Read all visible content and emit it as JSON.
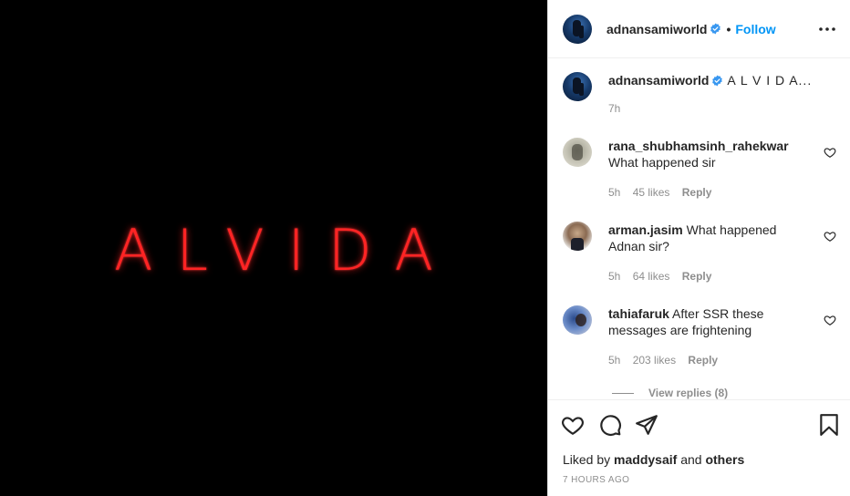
{
  "post": {
    "media_text": "ALVIDA",
    "username": "adnansamiworld",
    "follow_label": "Follow",
    "separator": "•"
  },
  "caption": {
    "username": "adnansamiworld",
    "text": "A L V I D A...",
    "time": "7h"
  },
  "comments": [
    {
      "username": "rana_shubhamsinh_rahekwar",
      "text": "What happened sir",
      "time": "5h",
      "likes": "45 likes",
      "reply": "Reply"
    },
    {
      "username": "arman.jasim",
      "text": "What happened Adnan sir?",
      "time": "5h",
      "likes": "64 likes",
      "reply": "Reply"
    },
    {
      "username": "tahiafaruk",
      "text": "After SSR these messages are frightening",
      "time": "5h",
      "likes": "203 likes",
      "reply": "Reply"
    }
  ],
  "view_replies": "View replies (8)",
  "likes_summary": {
    "prefix": "Liked by",
    "user": "maddysaif",
    "and": "and",
    "others": "others"
  },
  "timestamp": "7 HOURS AGO",
  "icons": [
    "verified-badge-icon",
    "more-options-icon",
    "heart-icon",
    "comment-icon",
    "share-icon",
    "bookmark-icon"
  ],
  "colors": {
    "accent": "#0095f6",
    "media_text": "#ff2424",
    "muted": "#8e8e8e",
    "text": "#262626"
  }
}
